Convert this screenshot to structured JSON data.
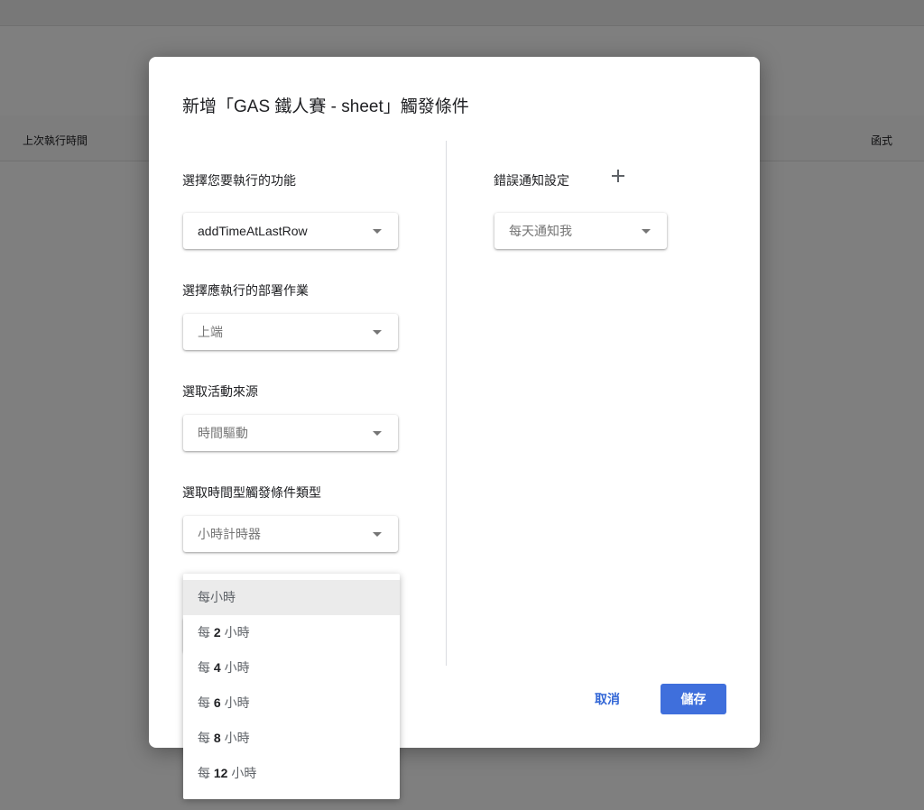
{
  "background": {
    "columns": [
      "上次執行時間",
      "函式"
    ]
  },
  "dialog": {
    "title": "新增「GAS 鐵人賽 - sheet」觸發條件",
    "left": {
      "function": {
        "label": "選擇您要執行的功能",
        "value": "addTimeAtLastRow"
      },
      "deployment": {
        "label": "選擇應執行的部署作業",
        "value": "上端"
      },
      "event_source": {
        "label": "選取活動來源",
        "value": "時間驅動"
      },
      "timer_type": {
        "label": "選取時間型觸發條件類型",
        "value": "小時計時器"
      }
    },
    "right": {
      "notify": {
        "label": "錯誤通知設定",
        "value": "每天通知我"
      }
    },
    "cancel_label": "取消",
    "save_label": "儲存"
  },
  "interval_menu": {
    "items": [
      {
        "prefix": "每",
        "num": "",
        "suffix": "小時",
        "selected": true
      },
      {
        "prefix": "每 ",
        "num": "2",
        "suffix": " 小時",
        "selected": false
      },
      {
        "prefix": "每 ",
        "num": "4",
        "suffix": " 小時",
        "selected": false
      },
      {
        "prefix": "每 ",
        "num": "6",
        "suffix": " 小時",
        "selected": false
      },
      {
        "prefix": "每 ",
        "num": "8",
        "suffix": " 小時",
        "selected": false
      },
      {
        "prefix": "每 ",
        "num": "12",
        "suffix": " 小時",
        "selected": false
      }
    ]
  },
  "colors": {
    "primary": "#3f6fdc",
    "link": "#3367d6",
    "highlight": "#ebebeb"
  }
}
